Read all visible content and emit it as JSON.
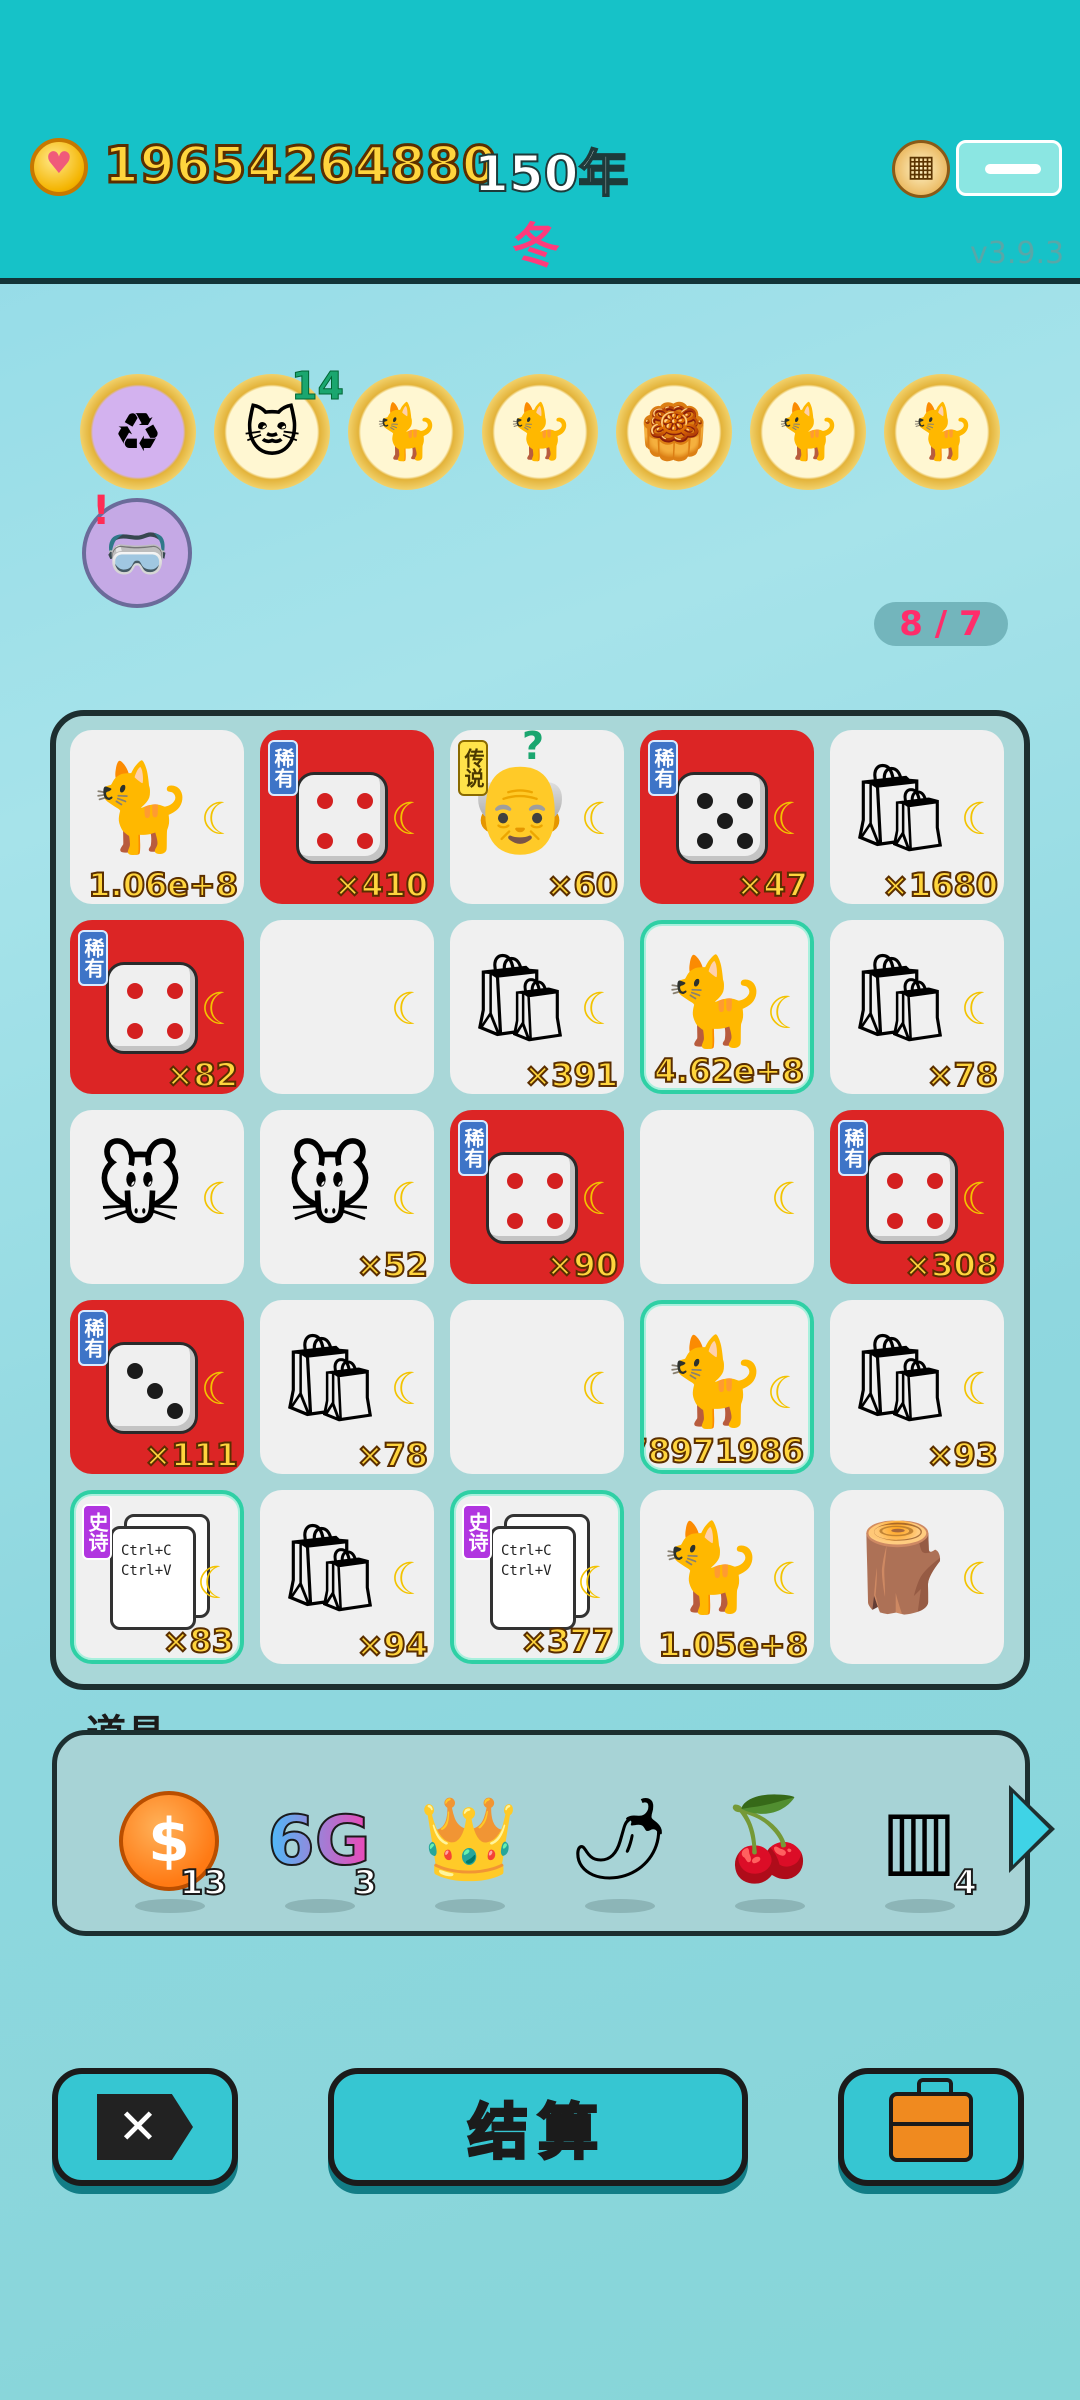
{
  "header": {
    "coins": "19654264880",
    "year": "150年",
    "season": "冬",
    "version": "v3.9.3"
  },
  "stickers": [
    {
      "icon": "recycle-icon",
      "glyph": "♻",
      "purple": true,
      "badge": ""
    },
    {
      "icon": "cat-sprout-icon",
      "glyph": "🐱",
      "purple": false,
      "badge": "14"
    },
    {
      "icon": "cat-pair-icon",
      "glyph": "🐈",
      "purple": false,
      "badge": ""
    },
    {
      "icon": "cat-pair-icon",
      "glyph": "🐈",
      "purple": false,
      "badge": ""
    },
    {
      "icon": "mooncake-icon",
      "glyph": "🥮",
      "purple": false,
      "badge": ""
    },
    {
      "icon": "cat-pair-icon",
      "glyph": "🐈",
      "purple": false,
      "badge": ""
    },
    {
      "icon": "cat-pair-icon",
      "glyph": "🐈",
      "purple": false,
      "badge": ""
    }
  ],
  "extra_sticker": {
    "icon": "eyepatch-icon",
    "alert": "!"
  },
  "page_indicator": "8 / 7",
  "board": {
    "tiles": [
      {
        "kind": "cat",
        "bg": "plain",
        "tag": "",
        "count": "1.06e+8"
      },
      {
        "kind": "dice",
        "pips": 4,
        "red": true,
        "bg": "rare",
        "tag": "稀有",
        "count": "×410"
      },
      {
        "kind": "oldman",
        "bg": "plain",
        "tag": "传说",
        "count": "×60",
        "question": "?"
      },
      {
        "kind": "dice",
        "pips": 5,
        "red": false,
        "bg": "rare",
        "tag": "稀有",
        "count": "×47"
      },
      {
        "kind": "bag",
        "bg": "plain",
        "tag": "",
        "count": "×1680"
      },
      {
        "kind": "dice",
        "pips": 4,
        "red": true,
        "bg": "rare",
        "tag": "稀有",
        "count": "×82"
      },
      {
        "kind": "empty",
        "bg": "plain",
        "tag": "",
        "count": ""
      },
      {
        "kind": "bag",
        "bg": "plain",
        "tag": "",
        "count": "×391"
      },
      {
        "kind": "cat",
        "bg": "epic",
        "tag": "",
        "count": "4.62e+8"
      },
      {
        "kind": "bag",
        "bg": "plain",
        "tag": "",
        "count": "×78"
      },
      {
        "kind": "mouse",
        "bg": "plain",
        "tag": "",
        "count": ""
      },
      {
        "kind": "mouse",
        "bg": "plain",
        "tag": "",
        "count": "×52"
      },
      {
        "kind": "dice",
        "pips": 4,
        "red": true,
        "bg": "rare",
        "tag": "稀有",
        "count": "×90"
      },
      {
        "kind": "empty",
        "bg": "plain",
        "tag": "",
        "count": ""
      },
      {
        "kind": "dice",
        "pips": 4,
        "red": true,
        "bg": "rare",
        "tag": "稀有",
        "count": "×308"
      },
      {
        "kind": "dice",
        "pips": 3,
        "red": false,
        "bg": "rare",
        "tag": "稀有",
        "count": "×111"
      },
      {
        "kind": "bag",
        "bg": "plain",
        "tag": "",
        "count": "×78"
      },
      {
        "kind": "empty",
        "bg": "plain",
        "tag": "",
        "count": ""
      },
      {
        "kind": "cat",
        "bg": "epic",
        "tag": "",
        "count": "78971986"
      },
      {
        "kind": "bag",
        "bg": "plain",
        "tag": "",
        "count": "×93"
      },
      {
        "kind": "copy",
        "bg": "epic",
        "tag": "史诗",
        "count": "×83",
        "text1": "Ctrl+C",
        "text2": "Ctrl+V"
      },
      {
        "kind": "bag",
        "bg": "plain",
        "tag": "",
        "count": "×94"
      },
      {
        "kind": "copy",
        "bg": "epic",
        "tag": "史诗",
        "count": "×377",
        "text1": "Ctrl+C",
        "text2": "Ctrl+V"
      },
      {
        "kind": "cat",
        "bg": "plain",
        "tag": "",
        "count": "1.05e+8"
      },
      {
        "kind": "log",
        "bg": "plain",
        "tag": "",
        "count": ""
      }
    ]
  },
  "tools": {
    "label": "道具",
    "items": [
      {
        "icon": "coin-dollar-icon",
        "glyph": "$",
        "qty": "13"
      },
      {
        "icon": "sixg-icon",
        "glyph": "6G",
        "qty": "3"
      },
      {
        "icon": "crown-icon",
        "glyph": "👑",
        "qty": ""
      },
      {
        "icon": "chili-icon",
        "glyph": "🌶",
        "qty": ""
      },
      {
        "icon": "lychee-icon",
        "glyph": "🍒",
        "qty": ""
      },
      {
        "icon": "rare-cards-icon",
        "glyph": "▥",
        "qty": "4"
      }
    ]
  },
  "buttons": {
    "close": "✕",
    "settle": "结算"
  },
  "colors": {
    "header_bg": "#16c2c8",
    "rare_tile": "#dc2525",
    "epic_border": "#2fd0a5",
    "count_text": "#ffd53d",
    "season_text": "#ff3b7c"
  }
}
